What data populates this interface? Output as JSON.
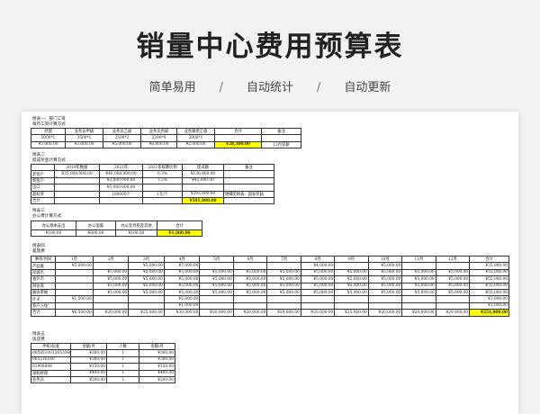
{
  "page": {
    "title": "销量中心费用预算表",
    "features": [
      "简单易用",
      "自动统计",
      "自动更新"
    ],
    "separator": "/"
  },
  "sheet1": {
    "heading": "附表一：部门工资",
    "sub": "每月工资计算方式",
    "header": [
      "经理",
      "业务员甲级",
      "业务员乙级",
      "业务员丙级",
      "业务跟单乙级",
      "合计",
      "备注"
    ],
    "row2": [
      "5000*1",
      "3500*1",
      "2500*2",
      "2200*4",
      "2000*1",
      "",
      ""
    ],
    "row3": [
      "¥5,000.00",
      "¥3,000.00",
      "¥5,000.00",
      "¥8,800.00",
      "¥2,000.00",
      "¥28,300.00",
      "13月双薪"
    ]
  },
  "sheet2": {
    "heading": "附表二",
    "sub": "提成奖金计算方式",
    "header": [
      "",
      "2019年数据",
      "2021年",
      "2021年核算比例",
      "提成额",
      "备注"
    ],
    "rows": [
      [
        "老客户",
        "¥35,000,000.00",
        "¥46,000,000.00",
        "0.3%",
        "¥138,000.00",
        ""
      ],
      [
        "新客户",
        "",
        "¥3,000,000.00",
        "1.5%",
        "¥45,000.00",
        ""
      ],
      [
        "出口",
        "",
        "¥5,000,000.00",
        "",
        "",
        ""
      ],
      [
        "超标奖",
        "",
        "100000个",
        "1元/个",
        "¥293,000.00",
        "明细见附表：超标奖励"
      ],
      [
        "合计",
        "",
        "",
        "",
        "¥581,000.00",
        ""
      ]
    ]
  },
  "sheet3": {
    "heading": "附表三",
    "sub": "办公费计算方式",
    "header": [
      "办公基本支出",
      "办公电脑",
      "办公室月租及其他",
      "合计"
    ],
    "values": [
      "¥100.00",
      "¥800.00",
      "¥100.00",
      "¥1,000.00"
    ]
  },
  "sheet4": {
    "heading": "附表四",
    "sub": "差旅费",
    "header": [
      "事项/时间",
      "1月",
      "2月",
      "3月",
      "4月",
      "5月",
      "6月",
      "7月",
      "8月",
      "9月",
      "10月",
      "11月",
      "12月",
      "合计"
    ],
    "rows": [
      [
        "产品推",
        "¥5,000.00",
        "",
        "¥5,000.00",
        "¥7,000.00",
        "",
        "",
        "",
        "¥4,000.00",
        "",
        "¥5,000.00",
        "",
        "",
        "¥35,000.00"
      ],
      [
        "同城市",
        "",
        "¥5,000.00",
        "¥5,000.00",
        "¥5,000.00",
        "¥5,000.00",
        "¥5,000.00",
        "¥5,000.00",
        "¥5,000.00",
        "¥5,000.00",
        "¥5,000.00",
        "¥5,000.00",
        "¥5,000.00",
        "¥55,000.00"
      ],
      [
        "省外市",
        "",
        "¥5,000.00",
        "¥5,000.00",
        "¥5,000.00",
        "¥5,000.00",
        "¥5,000.00",
        "¥5,000.00",
        "¥5,000.00",
        "¥5,000.00",
        "¥5,000.00",
        "¥5,000.00",
        "¥5,000.00",
        "¥55,000.00"
      ],
      [
        "拜访商",
        "",
        "¥5,000.00",
        "¥5,000.00",
        "¥5,000.00",
        "¥5,000.00",
        "¥5,000.00",
        "¥5,000.00",
        "¥5,000.00",
        "¥5,000.00",
        "¥5,000.00",
        "¥5,000.00",
        "¥5,000.00",
        "¥55,000.00"
      ],
      [
        "展会参展",
        "",
        "¥5,000.00",
        "¥5,000.00",
        "¥5,000.00",
        "¥5,000.00",
        "¥5,000.00",
        "¥5,000.00",
        "¥5,000.00",
        "¥5,000.00",
        "¥5,000.00",
        "¥5,000.00",
        "¥5,000.00",
        "¥55,000.00"
      ],
      [
        "叶子",
        "¥1,500.00",
        "",
        "",
        "¥2,000.00",
        "",
        "",
        "",
        "",
        "",
        "",
        "",
        "",
        "¥3,000.00"
      ],
      [
        "客户入住",
        "",
        "",
        "",
        "¥1,000.00",
        "",
        "",
        "",
        "",
        "",
        "",
        "",
        "",
        "¥1,000.00"
      ],
      [
        "合计",
        "¥6,500.00",
        "¥20,000.00",
        "¥25,000.00",
        "¥30,000.00",
        "¥20,000.00",
        "¥20,000.00",
        "¥24,000.00",
        "¥20,000.00",
        "¥25,000.00",
        "¥20,000.00",
        "¥20,000.00",
        "¥20,000.00",
        "¥251,000.00"
      ]
    ]
  },
  "sheet5": {
    "heading": "附表五",
    "sub": "饭店费",
    "header": [
      "手机/标准",
      "金额/月",
      "人数",
      "金额/月"
    ],
    "rows": [
      [
        "0659510013651046",
        "¥300.00",
        "1",
        "¥300.00"
      ],
      [
        "065516180",
        "¥300.00",
        "1",
        "¥300.00"
      ],
      [
        "81908008",
        "¥150.00",
        "1",
        "¥150.00"
      ],
      [
        "采购经理",
        "¥400.00",
        "1",
        "¥400.00"
      ],
      [
        "业务员",
        "¥200.00",
        "1",
        "¥200.00"
      ]
    ]
  }
}
